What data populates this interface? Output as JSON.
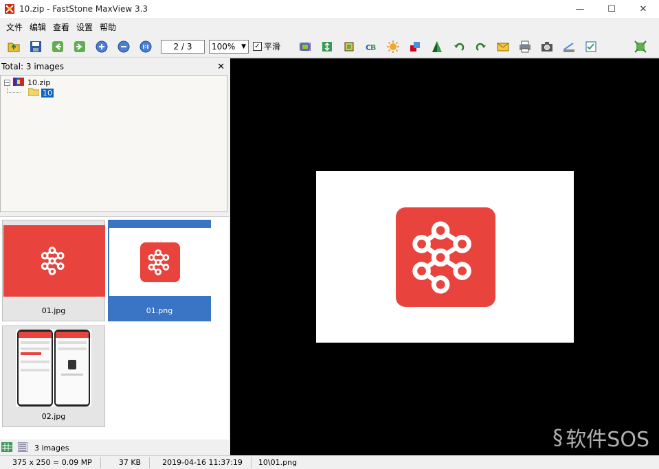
{
  "window": {
    "title": "10.zip - FastStone MaxView 3.3",
    "minimize": "—",
    "maximize": "☐",
    "close": "✕"
  },
  "menu": [
    "文件",
    "编辑",
    "查看",
    "设置",
    "帮助"
  ],
  "toolbar": {
    "page": "2 / 3",
    "zoom": "100%",
    "smooth_label": "平滑",
    "smooth_checked": "✓"
  },
  "left": {
    "total": "Total: 3 images",
    "close": "✕",
    "tree": {
      "root": "10.zip",
      "folder": "10"
    },
    "thumbnails": [
      {
        "name": "01.jpg"
      },
      {
        "name": "01.png"
      },
      {
        "name": "02.jpg"
      }
    ],
    "footer_count": "3 images"
  },
  "status": {
    "dimensions": "375 x 250 = 0.09 MP",
    "size": "37 KB",
    "date": "2019-04-16 11:37:19",
    "path": "10\\01.png"
  },
  "watermark": "软件SOS",
  "colors": {
    "accent": "#3a74c4",
    "logo_red": "#e8433c"
  }
}
